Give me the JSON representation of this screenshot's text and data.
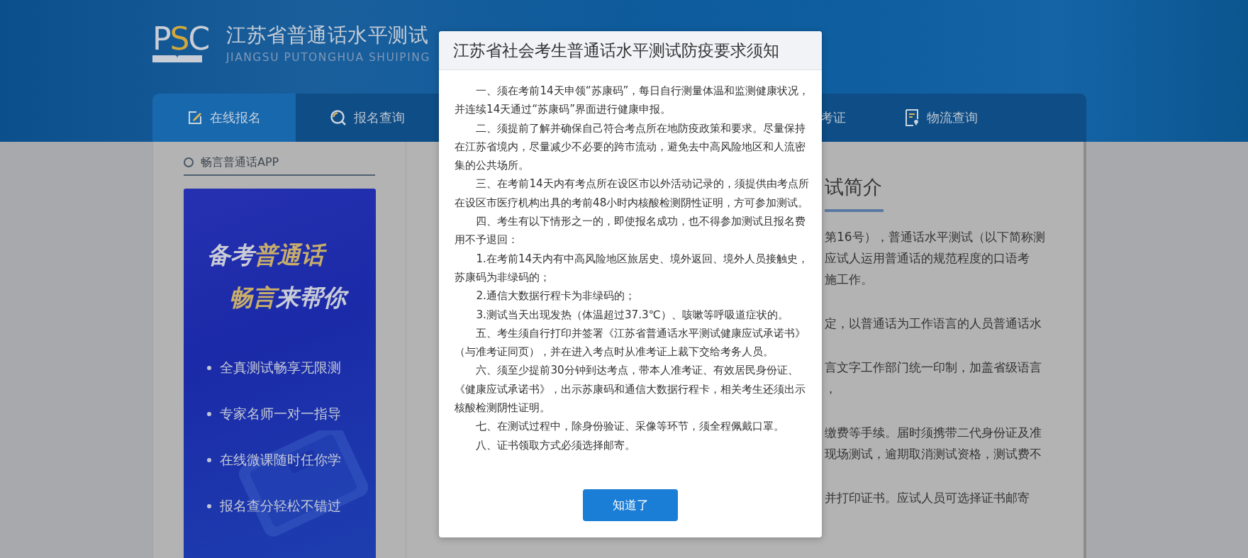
{
  "header": {
    "logo": [
      {
        "text": "P",
        "accent": false
      },
      {
        "text": "S",
        "accent": true
      },
      {
        "text": "C",
        "accent": false
      }
    ],
    "title": "江苏省普通话水平测试",
    "subtitle": "JIANGSU PUTONGHUA SHUIPING"
  },
  "nav": [
    {
      "label": "在线报名",
      "kind": "edit",
      "selected": true
    },
    {
      "label": "报名查询",
      "kind": "search",
      "selected": false
    },
    {
      "label": "考证",
      "kind": "plain",
      "selected": false
    },
    {
      "label": "物流查询",
      "kind": "document",
      "selected": false
    }
  ],
  "sidebar": {
    "title": "畅言普通话APP",
    "banner": {
      "headline": [
        [
          {
            "text": "备考",
            "accent": false
          },
          {
            "text": "普通话",
            "accent": true
          }
        ],
        [
          {
            "text": "畅言",
            "accent": true
          },
          {
            "text": "来帮你",
            "accent": false
          }
        ]
      ],
      "features": [
        "全真测试畅享无限测",
        "专家名师一对一指导",
        "在线微课随时任你学",
        "报名查分轻松不错过"
      ]
    }
  },
  "main": {
    "heading": "试简介",
    "paragraphs": [
      [
        "第16号），普通话水平测试（以下简称测",
        "应试人运用普通话的规范程度的口语考",
        "施工作。"
      ],
      [
        "定，以普通话为工作语言的人员普通话水"
      ],
      [
        "言文字工作部门统一印制，加盖省级语言",
        "，"
      ],
      [
        "缴费等手续。届时须携带二代身份证及准",
        "现场测试，逾期取消测试资格，测试费不"
      ],
      [
        "并打印证书。应试人员可选择证书邮寄"
      ]
    ]
  },
  "dialog": {
    "title": "江苏省社会考生普通话水平测试防疫要求须知",
    "paragraphs": [
      "一、须在考前14天申领“苏康码”，每日自行测量体温和监测健康状况，并连续14天通过“苏康码”界面进行健康申报。",
      "二、须提前了解并确保自己符合考点所在地防疫政策和要求。尽量保持在江苏省境内，尽量减少不必要的跨市流动，避免去中高风险地区和人流密集的公共场所。",
      "三、在考前14天内有考点所在设区市以外活动记录的，须提供由考点所在设区市医疗机构出具的考前48小时内核酸检测阴性证明，方可参加测试。",
      "四、考生有以下情形之一的，即使报名成功，也不得参加测试且报名费用不予退回：",
      "1.在考前14天内有中高风险地区旅居史、境外返回、境外人员接触史，苏康码为非绿码的；",
      "2.通信大数据行程卡为非绿码的；",
      "3.测试当天出现发热（体温超过37.3℃）、咳嗽等呼吸道症状的。",
      "五、考生须自行打印并签署《江苏省普通话水平测试健康应试承诺书》（与准考证同页），并在进入考点时从准考证上裁下交给考务人员。",
      "六、须至少提前30分钟到达考点，带本人准考证、有效居民身份证、《健康应试承诺书》，出示苏康码和通信大数据行程卡，相关考生还须出示核酸检测阴性证明。",
      "七、在测试过程中，除身份验证、采像等环节，须全程佩戴口罩。",
      "八、证书领取方式必须选择邮寄。"
    ],
    "button": "知道了"
  }
}
